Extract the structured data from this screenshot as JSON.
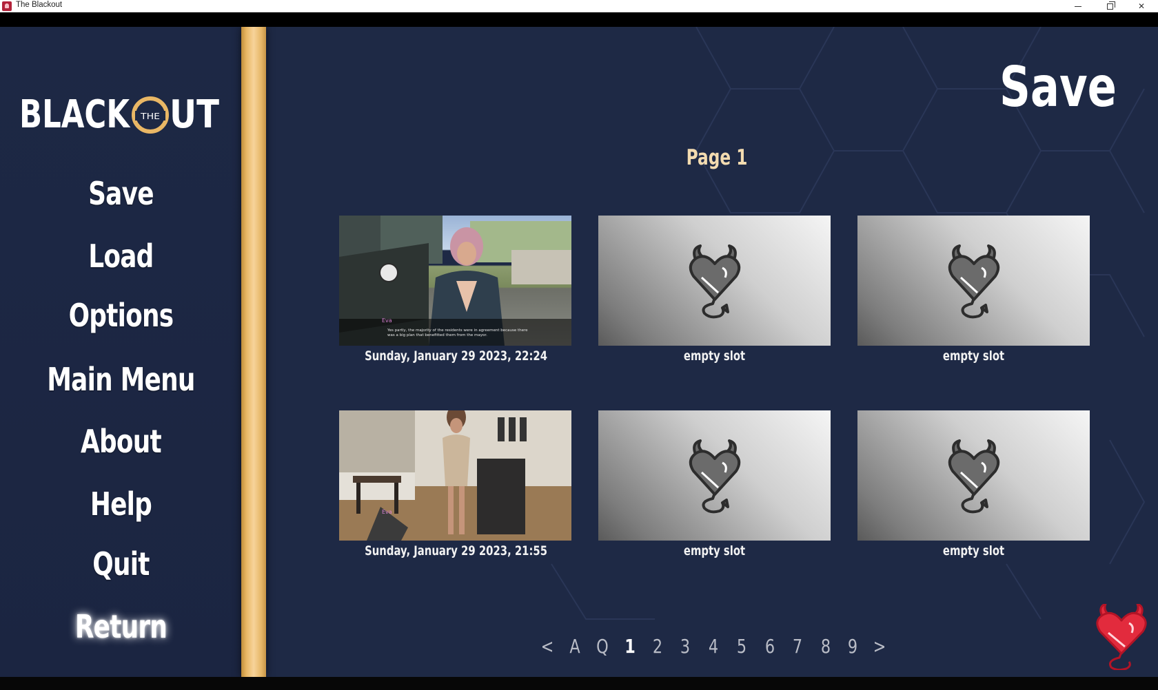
{
  "window": {
    "title": "The Blackout"
  },
  "brand": {
    "logo_text_left": "BLACK",
    "logo_text_the": "THE",
    "logo_text_right": "UT",
    "gold": "#e9b765",
    "logo_white": "#ffffff"
  },
  "nav": {
    "items": [
      {
        "label": "Save"
      },
      {
        "label": "Load"
      },
      {
        "label": "Options"
      },
      {
        "label": "Main Menu"
      },
      {
        "label": "About"
      },
      {
        "label": "Help"
      },
      {
        "label": "Quit"
      },
      {
        "label": "Return"
      }
    ],
    "hovered": "Return"
  },
  "screen": {
    "title": "Save",
    "page_label": "Page 1"
  },
  "slots": [
    {
      "caption": "Sunday, January 29 2023, 22:24",
      "filled": true,
      "thumb_scene": "outdoor",
      "thumb_text": "Yes partly, the majority of the residents were in agreement because there was a big plan that benefitted them from the mayor."
    },
    {
      "caption": "empty slot",
      "filled": false
    },
    {
      "caption": "empty slot",
      "filled": false
    },
    {
      "caption": "Sunday, January 29 2023, 21:55",
      "filled": true,
      "thumb_scene": "kitchen"
    },
    {
      "caption": "empty slot",
      "filled": false
    },
    {
      "caption": "empty slot",
      "filled": false
    }
  ],
  "pager": {
    "items": [
      "<",
      "A",
      "Q",
      "1",
      "2",
      "3",
      "4",
      "5",
      "6",
      "7",
      "8",
      "9",
      ">"
    ],
    "current": "1"
  },
  "colors": {
    "background": "#1e2945",
    "caption": "#f2f2f2",
    "page_label": "#f3dbb0",
    "accent_red": "#e22b3d"
  },
  "icons": {
    "empty_slot": "devil-heart-icon",
    "corner": "red-devil-heart-icon",
    "minimize": "minimize-icon",
    "restore": "restore-icon",
    "close": "close-icon"
  }
}
